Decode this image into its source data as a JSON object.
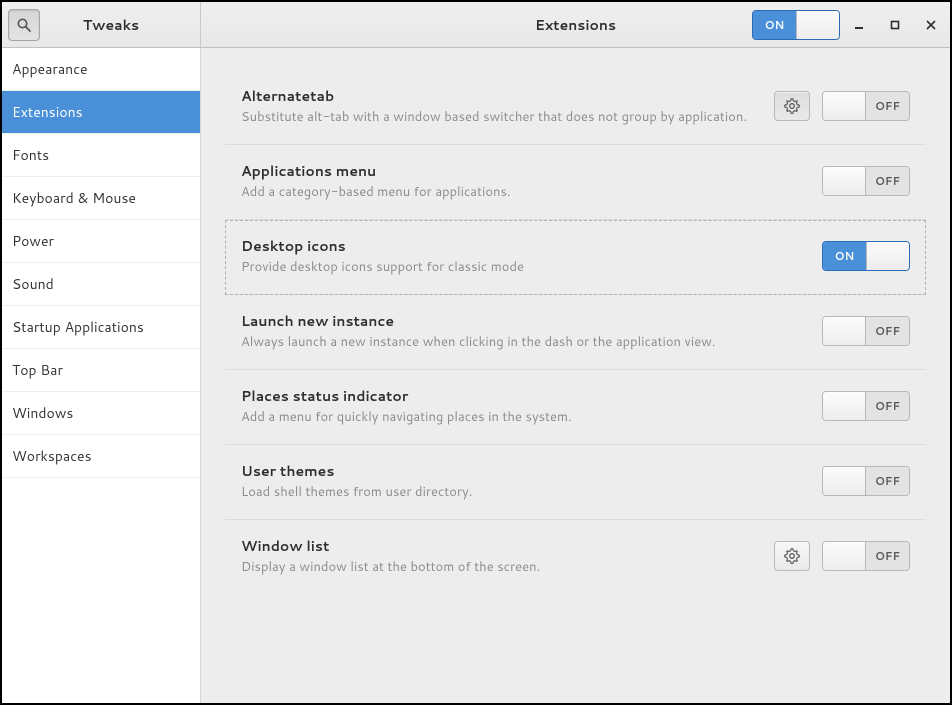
{
  "app_title": "Tweaks",
  "page_title": "Extensions",
  "master_switch": {
    "value": "ON",
    "state": "on"
  },
  "switch_labels": {
    "on": "ON",
    "off": "OFF"
  },
  "sidebar": {
    "items": [
      {
        "label": "Appearance"
      },
      {
        "label": "Extensions"
      },
      {
        "label": "Fonts"
      },
      {
        "label": "Keyboard & Mouse"
      },
      {
        "label": "Power"
      },
      {
        "label": "Sound"
      },
      {
        "label": "Startup Applications"
      },
      {
        "label": "Top Bar"
      },
      {
        "label": "Windows"
      },
      {
        "label": "Workspaces"
      }
    ],
    "selected_index": 1
  },
  "extensions": [
    {
      "title": "Alternatetab",
      "desc": "Substitute alt-tab with a window based switcher that does not group by application.",
      "has_gear": true,
      "state": "off",
      "focused": false
    },
    {
      "title": "Applications menu",
      "desc": "Add a category-based menu for applications.",
      "has_gear": false,
      "state": "off",
      "focused": false
    },
    {
      "title": "Desktop icons",
      "desc": "Provide desktop icons support for classic mode",
      "has_gear": false,
      "state": "on",
      "focused": true
    },
    {
      "title": "Launch new instance",
      "desc": "Always launch a new instance when clicking in the dash or the application view.",
      "has_gear": false,
      "state": "off",
      "focused": false
    },
    {
      "title": "Places status indicator",
      "desc": "Add a menu for quickly navigating places in the system.",
      "has_gear": false,
      "state": "off",
      "focused": false
    },
    {
      "title": "User themes",
      "desc": "Load shell themes from user directory.",
      "has_gear": false,
      "state": "off",
      "focused": false
    },
    {
      "title": "Window list",
      "desc": "Display a window list at the bottom of the screen.",
      "has_gear": true,
      "state": "off",
      "focused": false
    }
  ]
}
